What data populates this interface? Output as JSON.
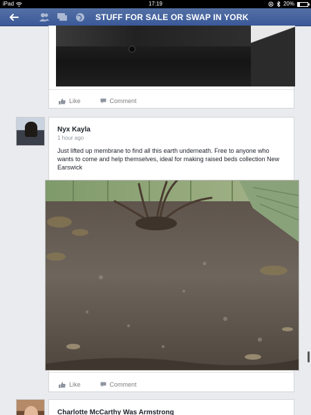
{
  "status_bar": {
    "device": "iPad",
    "time": "17:19",
    "battery": "20%",
    "battery_level": 0.2
  },
  "nav": {
    "title": "STUFF FOR SALE OR SWAP IN YORK",
    "icons": [
      "back-arrow-icon",
      "friends-icon",
      "messages-icon",
      "globe-icon"
    ]
  },
  "feed": {
    "posts": [
      {
        "actions": {
          "like": "Like",
          "comment": "Comment"
        }
      },
      {
        "author": "Nyx Kayla",
        "time": "1 hour ago",
        "text": "Just lifted up membrane to find all this earth underneath. Free to anyone who wants to come and help themselves,  ideal for making raised beds collection New Earswick",
        "actions": {
          "like": "Like",
          "comment": "Comment"
        }
      },
      {
        "author": "Charlotte McCarthy Was Armstrong"
      }
    ]
  },
  "colors": {
    "nav_bg": "#3b5998",
    "page_bg": "#e9ebee",
    "action_text": "#7f7f7f"
  }
}
